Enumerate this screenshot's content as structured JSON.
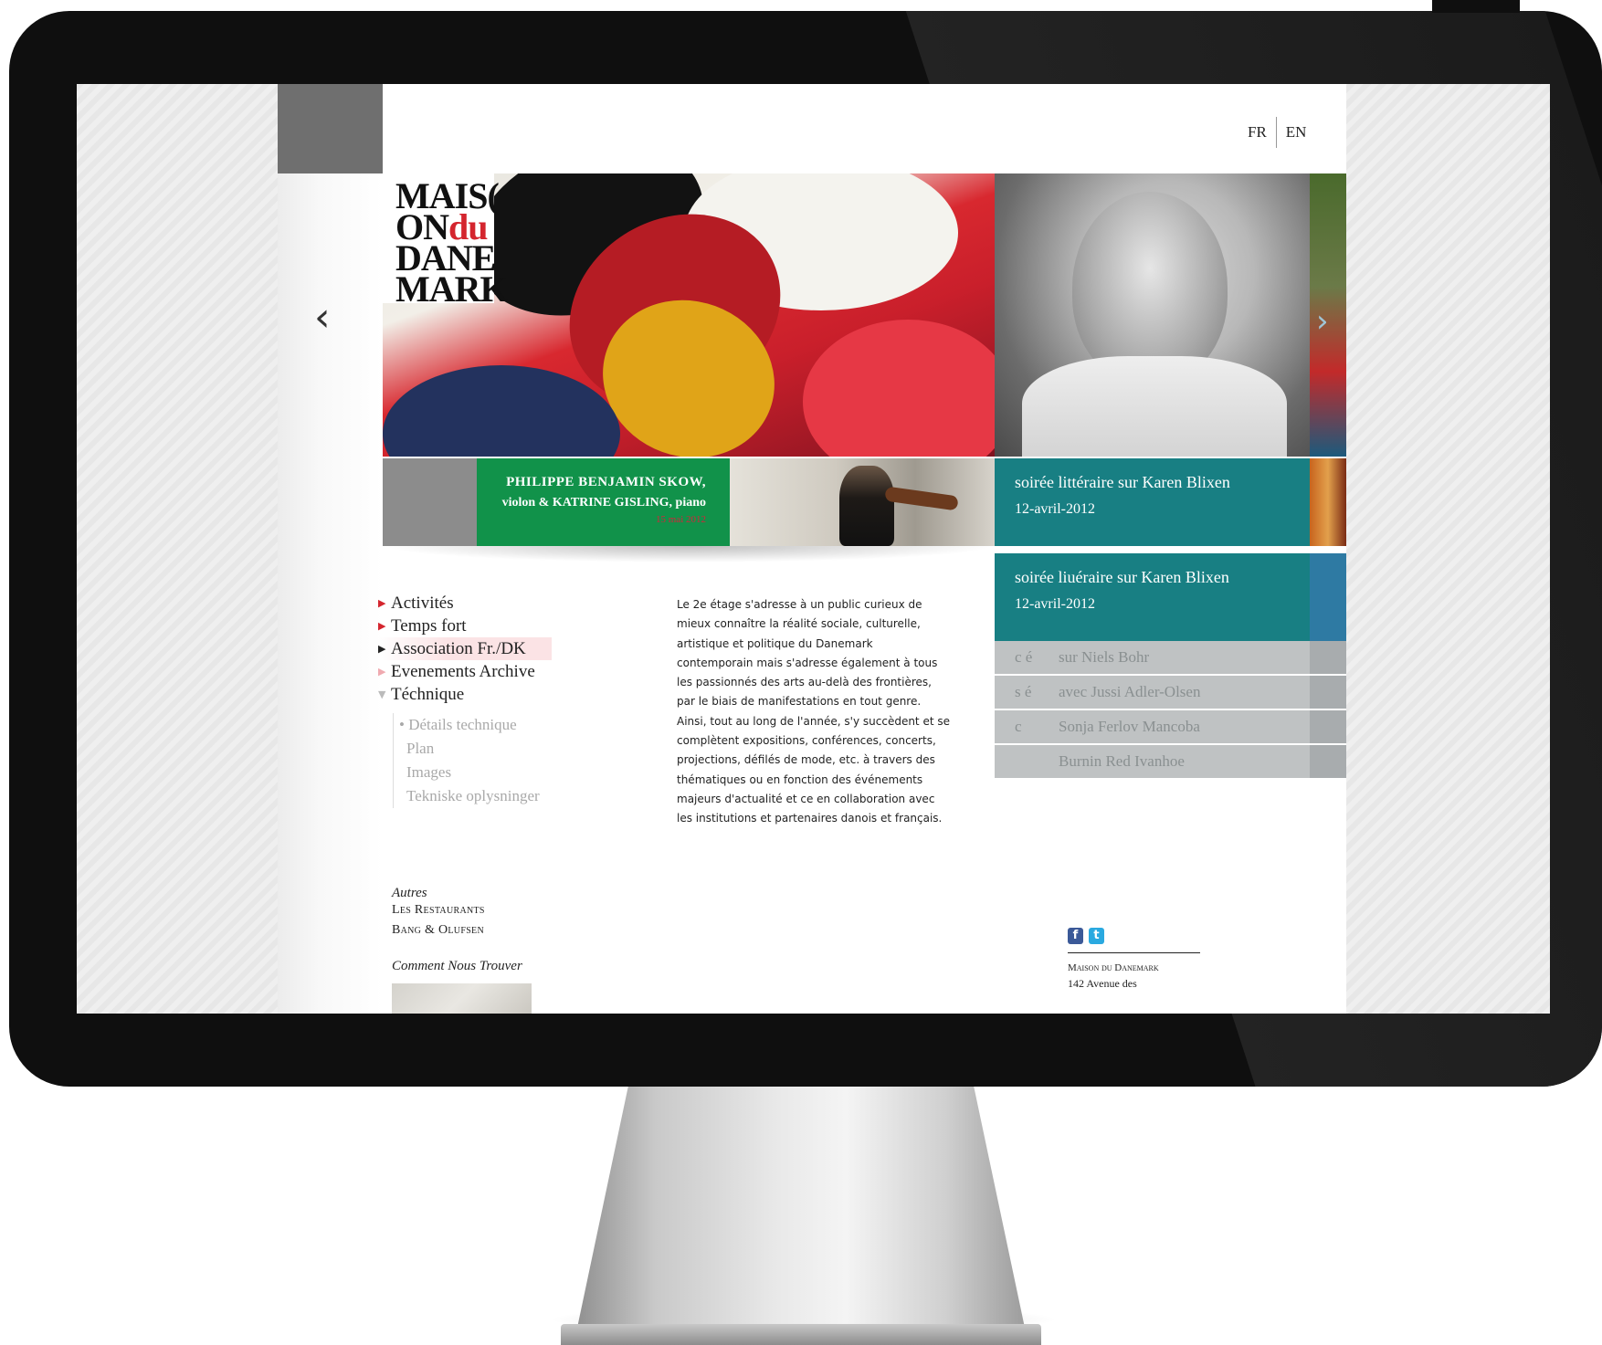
{
  "language": {
    "fr": "FR",
    "en": "EN"
  },
  "logo": {
    "line1": "MAIS(",
    "line2a": "ON",
    "line2b": "du",
    "line3": "DANE",
    "line4": "MARK"
  },
  "slider": {
    "prev_icon": "chevron-left-icon",
    "next_icon": "chevron-right-icon",
    "prev_glyph": "‹",
    "next_glyph": "›"
  },
  "banner": {
    "concert": {
      "title": "PHILIPPE BENJAMIN SKOW,",
      "subtitle": "violon & KATRINE GISLING, piano",
      "date": "15 mai 2012"
    },
    "event": {
      "title": "soirée littéraire sur Karen Blixen",
      "date": "12-avril-2012"
    }
  },
  "events": {
    "featured": {
      "title": "soirée liuéraire sur Karen Blixen",
      "date": "12-avril-2012"
    },
    "rows": [
      {
        "prefix": "c   é",
        "label": "sur Niels Bohr"
      },
      {
        "prefix": "s   é",
        "label": "avec Jussi Adler-Olsen"
      },
      {
        "prefix": "c",
        "label": "Sonja Ferlov Mancoba"
      },
      {
        "prefix": "",
        "label": "Burnin Red Ivanhoe"
      }
    ]
  },
  "nav": {
    "items": [
      {
        "label": "Activités"
      },
      {
        "label": "Temps fort"
      },
      {
        "label": "Association Fr./DK"
      },
      {
        "label": "Evenements Archive"
      },
      {
        "label": "Téchnique"
      }
    ],
    "sub_items": [
      "• Détails technique",
      "Plan",
      "Images",
      "Tekniske oplysninger"
    ]
  },
  "intro_text": "Le 2e étage s'adresse à un public curieux de mieux connaître la réalité sociale, culturelle, artistique et politique du Danemark contemporain mais s'adresse également à tous les passionnés des arts au-delà des frontières, par le biais de manifestations en tout genre. Ainsi, tout au long de l'année, s'y succèdent et se complètent expositions, conférences, concerts, projections, défilés de mode, etc. à travers des thématiques ou en fonction des événements majeurs d'actualité et ce en collaboration avec les institutions et partenaires danois et français.",
  "autres": {
    "header": "Autres",
    "links": [
      "Les Restaurants",
      "Bang & Olufsen"
    ]
  },
  "find_us": "Comment Nous Trouver",
  "social": {
    "facebook": "f",
    "twitter": "t"
  },
  "footer": {
    "name": "Maison du Danemark",
    "address": "142 Avenue des"
  },
  "colors": {
    "accent_red": "#d4252e",
    "green": "#11924a",
    "teal": "#187f83",
    "bezel": "#0f0f0f"
  }
}
